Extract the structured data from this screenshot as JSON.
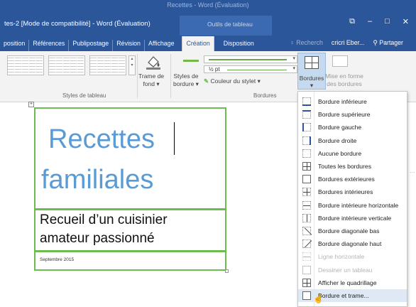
{
  "window": {
    "ghost_title": "Recettes - Word (Évaluation)",
    "doc_title": "tes-2 [Mode de compatibilité] - Word (Évaluation)",
    "tools_label": "Outils de tableau",
    "buttons": {
      "restore": "⧉",
      "minimize": "–",
      "maximize": "□",
      "close": "✕"
    }
  },
  "tabs": [
    {
      "label": "position"
    },
    {
      "label": "Références"
    },
    {
      "label": "Publipostage"
    },
    {
      "label": "Révision"
    },
    {
      "label": "Affichage"
    },
    {
      "label": "Création",
      "active": true
    },
    {
      "label": "Disposition"
    }
  ],
  "tabs_right": {
    "search": "♀ Recherch",
    "user": "cricri Eber...",
    "share": "Partager"
  },
  "ribbon": {
    "table_styles_caption": "Styles de tableau",
    "shading_label_1": "Trame de",
    "shading_label_2": "fond ▾",
    "border_styles_1": "Styles de",
    "border_styles_2": "bordure ▾",
    "pen_weight": "½ pt",
    "pen_color": "Couleur du stylet ▾",
    "borders_caption": "Bordures",
    "borders_button": "Bordures",
    "borders_button_arrow": "▾",
    "painter_1": "Mise en forme",
    "painter_2": "des bordures"
  },
  "document": {
    "title_line1": "Recettes",
    "title_line2": "familiales",
    "subtitle_line1": "Recueil d’un cuisinier",
    "subtitle_line2": "amateur passionné",
    "date": "Septembre 2015",
    "move_handle": "+"
  },
  "menu": {
    "items": [
      {
        "label": "Bordure inférieure",
        "icon": "border-bottom-icon",
        "enabled": true
      },
      {
        "label": "Bordure supérieure",
        "icon": "border-top-icon",
        "enabled": true
      },
      {
        "label": "Bordure gauche",
        "icon": "border-left-icon",
        "enabled": true
      },
      {
        "label": "Bordure droite",
        "icon": "border-right-icon",
        "enabled": true
      },
      {
        "label": "Aucune bordure",
        "icon": "no-border-icon",
        "enabled": true
      },
      {
        "label": "Toutes les bordures",
        "icon": "all-borders-icon",
        "enabled": true
      },
      {
        "label": "Bordures extérieures",
        "icon": "outside-borders-icon",
        "enabled": true
      },
      {
        "label": "Bordures intérieures",
        "icon": "inside-borders-icon",
        "enabled": true
      },
      {
        "label": "Bordure intérieure horizontale",
        "icon": "inside-horizontal-border-icon",
        "enabled": true
      },
      {
        "label": "Bordure intérieure verticale",
        "icon": "inside-vertical-border-icon",
        "enabled": true
      },
      {
        "label": "Bordure diagonale bas",
        "icon": "diagonal-down-border-icon",
        "enabled": true
      },
      {
        "label": "Bordure diagonale haut",
        "icon": "diagonal-up-border-icon",
        "enabled": true
      },
      {
        "label": "Ligne horizontale",
        "icon": "horizontal-line-icon",
        "enabled": false
      },
      {
        "label": "Dessiner un tableau",
        "icon": "draw-table-icon",
        "enabled": false
      },
      {
        "label": "Afficher le quadrillage",
        "icon": "view-gridlines-icon",
        "enabled": true
      },
      {
        "label": "Bordure et trame...",
        "icon": "borders-shading-icon",
        "enabled": true,
        "hover": true
      }
    ]
  },
  "colors": {
    "word_blue": "#2b579a",
    "table_border_green": "#6cbc4f",
    "title_blue": "#5b9bd5",
    "menu_hover": "#dfe9f5"
  }
}
